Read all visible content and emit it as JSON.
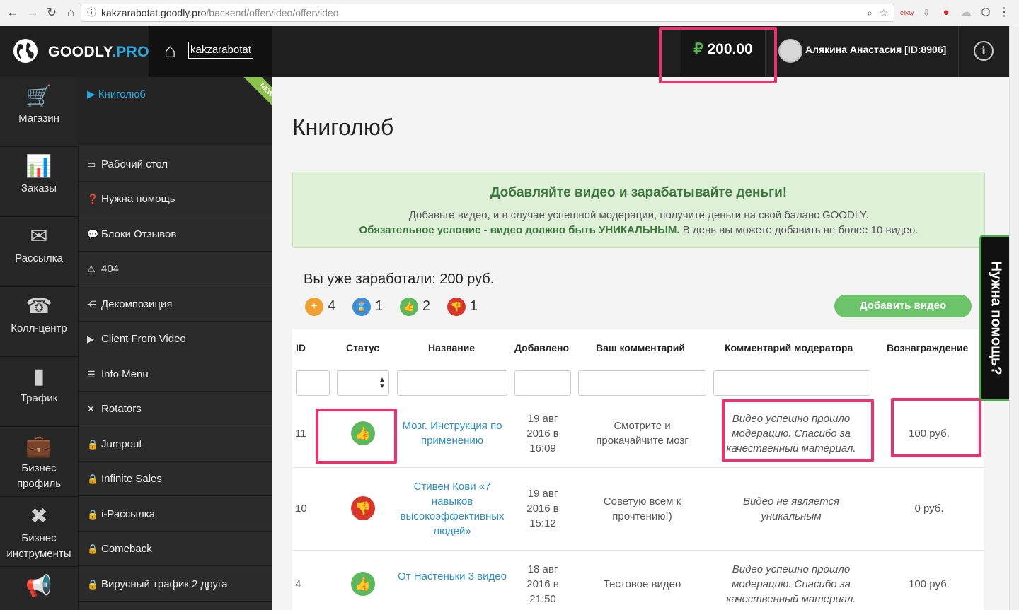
{
  "browser": {
    "url_host": "kakzarabotat.goodly.pro",
    "url_path": "/backend/offervideo/offervideo"
  },
  "header": {
    "logo_main": "GOODLY",
    "logo_suffix": ".PRO",
    "site_name": "kakzarabotat",
    "balance_currency": "₽",
    "balance_value": "200.00",
    "user_name": "Алякина Анастасия [ID:8906]"
  },
  "iconbar": [
    {
      "label": "Магазин",
      "icon": "cart-icon"
    },
    {
      "label": "Заказы",
      "icon": "chart-icon"
    },
    {
      "label": "Рассылка",
      "icon": "mail-icon"
    },
    {
      "label": "Колл-центр",
      "icon": "headset-icon"
    },
    {
      "label": "Трафик",
      "icon": "bars-icon"
    },
    {
      "label": "Бизнес профиль",
      "icon": "briefcase-icon"
    },
    {
      "label": "Бизнес инструменты",
      "icon": "tools-icon"
    },
    {
      "label": "",
      "icon": "megaphone-icon"
    }
  ],
  "menu": {
    "active": "Книголюб",
    "new_badge": "NEW",
    "items": [
      {
        "label": "Рабочий стол",
        "icon": "monitor-icon"
      },
      {
        "label": "Нужна помощь",
        "icon": "question-icon"
      },
      {
        "label": "Блоки Отзывов",
        "icon": "comments-icon"
      },
      {
        "label": "404",
        "icon": "warning-icon"
      },
      {
        "label": "Декомпозиция",
        "icon": "sitemap-icon"
      },
      {
        "label": "Client From Video",
        "icon": "play-icon"
      },
      {
        "label": "Info Menu",
        "icon": "list-icon"
      },
      {
        "label": "Rotators",
        "icon": "shuffle-icon"
      },
      {
        "label": "Jumpout",
        "icon": "lock-icon"
      },
      {
        "label": "Infinite Sales",
        "icon": "lock-icon"
      },
      {
        "label": "i-Рассылка",
        "icon": "lock-icon"
      },
      {
        "label": "Comeback",
        "icon": "lock-icon"
      },
      {
        "label": "Вирусный трафик 2 друга",
        "icon": "lock-icon"
      }
    ]
  },
  "main": {
    "title": "Книголюб",
    "banner": {
      "heading": "Добавляйте видео и зарабатывайте деньги!",
      "line1": "Добавьте видео, и в случае успешной модерации, получите деньги на свой баланс GOODLY.",
      "line2_bold": "Обязательное условие - видео должно быть УНИКАЛЬНЫМ.",
      "line2_rest": " В день вы можете добавить не более 10 видео."
    },
    "earned": "Вы уже заработали: 200 руб.",
    "stats": [
      {
        "count": "4",
        "icon": "plus-icon",
        "color": "#f0a030"
      },
      {
        "count": "1",
        "icon": "hourglass-icon",
        "color": "#3a8fd6"
      },
      {
        "count": "2",
        "icon": "thumbs-up-icon",
        "color": "#5cb85c"
      },
      {
        "count": "1",
        "icon": "thumbs-down-icon",
        "color": "#d9362b"
      }
    ],
    "add_button": "Добавить видео",
    "help_tab": "Нужна помощь?"
  },
  "table": {
    "headers": [
      "ID",
      "Статус",
      "Название",
      "Добавлено",
      "Ваш комментарий",
      "Комментарий модератора",
      "Вознаграждение"
    ],
    "rows": [
      {
        "id": "11",
        "status": "approved",
        "title": "Мозг. Инструкция по применению",
        "added": "19 авг 2016 в 16:09",
        "comment": "Смотрите и прокачайчите мозг",
        "moderator": "Видео успешно прошло модерацию. Спасибо за качественный материал.",
        "reward": "100 руб."
      },
      {
        "id": "10",
        "status": "rejected",
        "title": "Стивен Кови «7 навыков высокоэффективных людей»",
        "added": "19 авг 2016 в 15:12",
        "comment": "Советую всем к прочтению!)",
        "moderator": "Видео не является уникальным",
        "reward": "0 руб."
      },
      {
        "id": "4",
        "status": "approved",
        "title": "От Настеньки 3 видео",
        "added": "18 авг 2016 в 21:50",
        "comment": "Тестовое видео",
        "moderator": "Видео успешно прошло модерацию. Спасибо за качественный материал.",
        "reward": "100 руб."
      }
    ]
  },
  "colors": {
    "accent_blue": "#29a8e0",
    "highlight_pink": "#f0306e",
    "success_green": "#5cb85c",
    "danger_red": "#d9362b"
  }
}
